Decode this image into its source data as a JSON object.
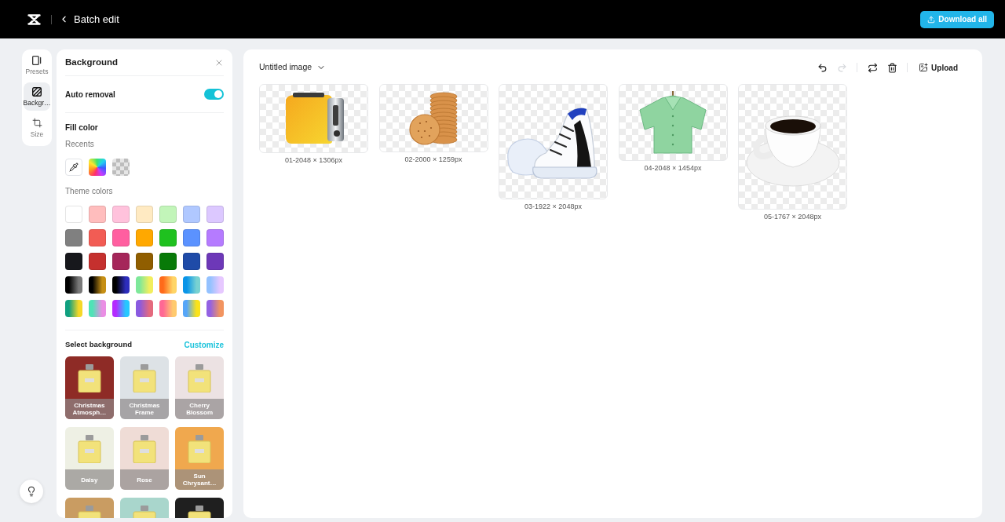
{
  "top_bar": {
    "title": "Batch edit",
    "download_label": "Download all"
  },
  "rail": [
    {
      "kind": "presets",
      "label": "Presets",
      "selected": false
    },
    {
      "kind": "background",
      "label": "Backgr…",
      "selected": true
    },
    {
      "kind": "size",
      "label": "Size",
      "selected": false
    }
  ],
  "panel": {
    "title": "Background",
    "auto_removal": {
      "label": "Auto removal",
      "on": true
    },
    "fill_color": {
      "title": "Fill color",
      "recents_label": "Recents",
      "recents": [
        {
          "kind": "eyedropper"
        },
        {
          "kind": "spectrum"
        },
        {
          "kind": "transparent"
        }
      ],
      "theme_label": "Theme colors",
      "theme_colors": [
        {
          "kind": "solid",
          "color": "#ffffff"
        },
        {
          "kind": "solid",
          "color": "#ffbdbd"
        },
        {
          "kind": "solid",
          "color": "#ffc2dc"
        },
        {
          "kind": "solid",
          "color": "#ffeac2"
        },
        {
          "kind": "solid",
          "color": "#c2f5b9"
        },
        {
          "kind": "solid",
          "color": "#b0c8ff"
        },
        {
          "kind": "solid",
          "color": "#dcc8ff"
        },
        {
          "kind": "solid",
          "color": "#808080"
        },
        {
          "kind": "solid",
          "color": "#f25c54"
        },
        {
          "kind": "solid",
          "color": "#ff5fa0"
        },
        {
          "kind": "solid",
          "color": "#ffa800"
        },
        {
          "kind": "solid",
          "color": "#1fc11f"
        },
        {
          "kind": "solid",
          "color": "#5b92ff"
        },
        {
          "kind": "solid",
          "color": "#b57bff"
        },
        {
          "kind": "solid",
          "color": "#17181c"
        },
        {
          "kind": "solid",
          "color": "#c5302e"
        },
        {
          "kind": "solid",
          "color": "#a5265a"
        },
        {
          "kind": "solid",
          "color": "#905e00"
        },
        {
          "kind": "solid",
          "color": "#087a08"
        },
        {
          "kind": "solid",
          "color": "#1f4ba8"
        },
        {
          "kind": "solid",
          "color": "#6d38b8"
        },
        {
          "kind": "gradient",
          "color": "#000000",
          "end": {
            "color": "#7a7a7a"
          }
        },
        {
          "kind": "gradient",
          "color": "#000000",
          "end": {
            "color": "#c68f14"
          }
        },
        {
          "kind": "gradient",
          "color": "#000000",
          "end": {
            "color": "#2d2dbd"
          }
        },
        {
          "kind": "gradient",
          "color": "#7ee89a",
          "end": {
            "color": "#f2ee5e"
          }
        },
        {
          "kind": "gradient",
          "color": "#ff6a1a",
          "end": {
            "color": "#ffd566"
          }
        },
        {
          "kind": "gradient",
          "color": "#0a95e8",
          "end": {
            "color": "#78d2d2"
          }
        },
        {
          "kind": "gradient",
          "color": "#94c2ff",
          "end": {
            "color": "#e6c8ff"
          }
        },
        {
          "kind": "gradient",
          "color": "#10a080",
          "end": {
            "color": "#f5d828"
          }
        },
        {
          "kind": "gradient",
          "color": "#4fe3b6",
          "end": {
            "color": "#ea8ee4"
          }
        },
        {
          "kind": "gradient",
          "color": "#b42cff",
          "end": {
            "color": "#26c8ff"
          }
        },
        {
          "kind": "gradient",
          "color": "#8a5ae0",
          "end": {
            "color": "#e46a7e"
          }
        },
        {
          "kind": "gradient",
          "color": "#ff6894",
          "end": {
            "color": "#ffca6e"
          }
        },
        {
          "kind": "gradient",
          "color": "#56a6f8",
          "end": {
            "color": "#fae21a"
          }
        },
        {
          "kind": "gradient",
          "color": "#9462e2",
          "end": {
            "color": "#f29460"
          }
        }
      ]
    },
    "select_background": {
      "title": "Select background",
      "action": "Customize",
      "options": [
        {
          "label": "Christmas Atmosph…",
          "color": "#8e2b26"
        },
        {
          "label": "Christmas Frame",
          "color": "#dde2e6"
        },
        {
          "label": "Cherry Blossom",
          "color": "#ece2e3"
        },
        {
          "label": "Daisy",
          "color": "#eef0e4"
        },
        {
          "label": "Rose",
          "color": "#efdcd6"
        },
        {
          "label": "Sun Chrysant…",
          "color": "#f0a84e"
        },
        {
          "color": "#c99c62"
        },
        {
          "color": "#a9d6cc"
        },
        {
          "color": "#1f1f1f"
        }
      ]
    }
  },
  "canvas": {
    "title": "Untitled image",
    "toolbar": [
      {
        "kind": "undo",
        "disabled": false
      },
      {
        "kind": "redo",
        "disabled": true
      },
      {
        "kind": "separator"
      },
      {
        "kind": "loop",
        "disabled": false
      },
      {
        "kind": "delete",
        "disabled": false
      },
      {
        "kind": "separator"
      },
      {
        "kind": "upload",
        "label": "Upload"
      }
    ],
    "images": [
      {
        "kind": "toaster",
        "caption": "01-2048 × 1306px"
      },
      {
        "kind": "cookies",
        "caption": "02-2000 × 1259px"
      },
      {
        "kind": "sneaker",
        "caption": "03-1922 × 2048px"
      },
      {
        "kind": "shirt",
        "caption": "04-2048 × 1454px"
      },
      {
        "kind": "cup",
        "caption": "05-1767 × 2048px"
      }
    ]
  }
}
